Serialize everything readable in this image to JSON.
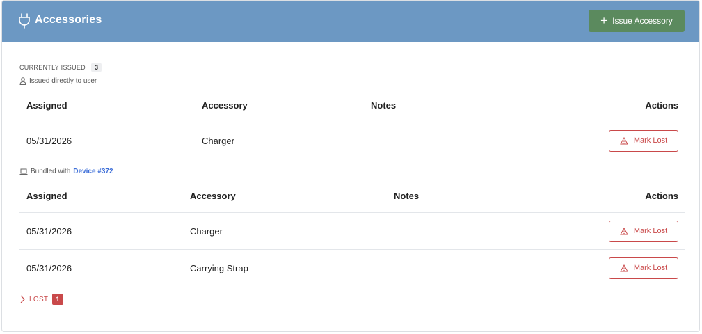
{
  "header": {
    "title": "Accessories",
    "issue_button_label": "Issue Accessory",
    "background_color": "#6c98c3",
    "issue_button_color": "#5b8a5e"
  },
  "current": {
    "label": "CURRENTLY ISSUED",
    "count": "3",
    "direct_group": {
      "label": "Issued directly to user",
      "columns": [
        "Assigned",
        "Accessory",
        "Notes",
        "Actions"
      ],
      "rows": [
        {
          "assigned": "05/31/2026",
          "accessory": "Charger",
          "notes": "",
          "action": "Mark Lost"
        }
      ]
    },
    "bundled_group": {
      "label_prefix": "Bundled with",
      "device_link": "Device #372",
      "columns": [
        "Assigned",
        "Accessory",
        "Notes",
        "Actions"
      ],
      "rows": [
        {
          "assigned": "05/31/2026",
          "accessory": "Charger",
          "notes": "",
          "action": "Mark Lost"
        },
        {
          "assigned": "05/31/2026",
          "accessory": "Carrying Strap",
          "notes": "",
          "action": "Mark Lost"
        }
      ]
    }
  },
  "lost": {
    "label": "LOST",
    "count": "1",
    "color": "#c9494a"
  },
  "icons": {
    "header": "plug-icon",
    "direct_group": "user-icon",
    "bundled_group": "laptop-icon",
    "action": "warning-triangle-icon",
    "lost_toggle": "chevron-right-icon"
  }
}
